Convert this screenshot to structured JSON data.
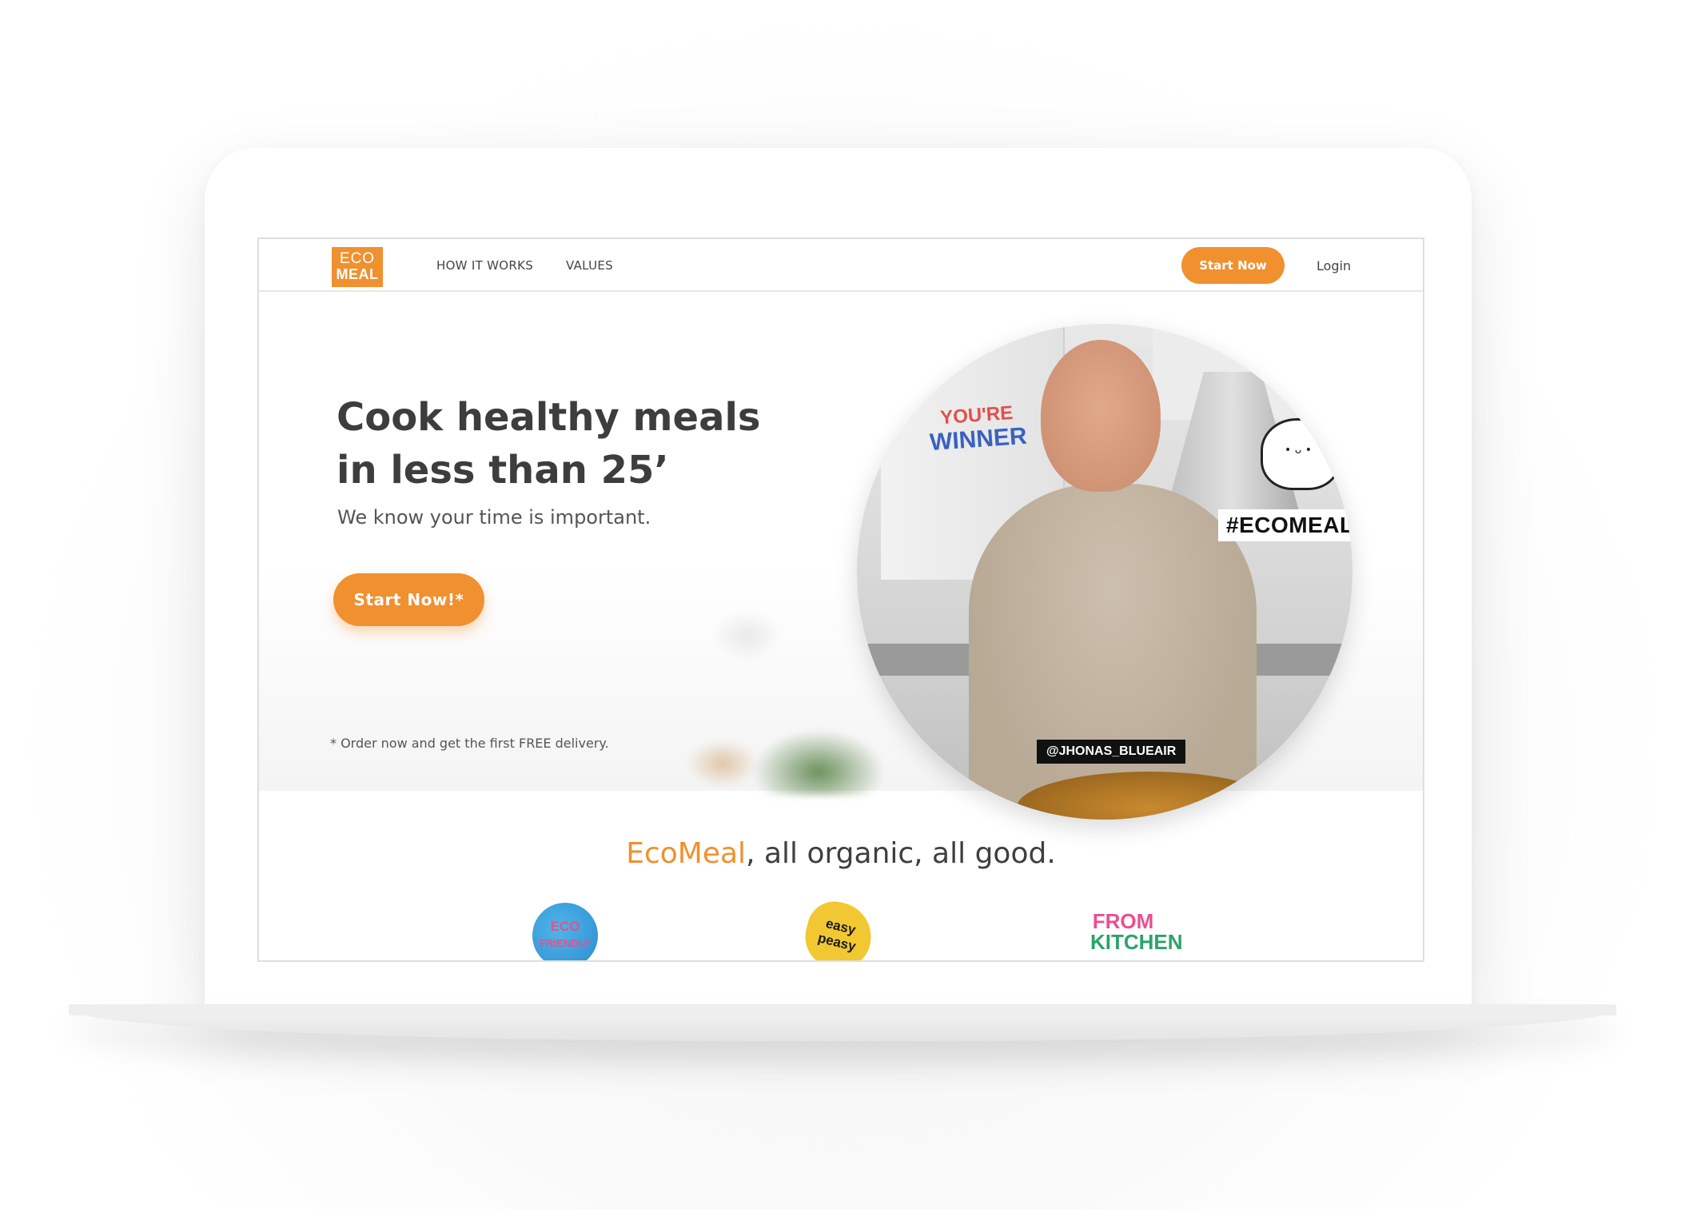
{
  "nav": {
    "logo_line1": "ECO",
    "logo_line2": "MEAL",
    "links": [
      "HOW IT WORKS",
      "VALUES"
    ],
    "start_label": "Start Now",
    "login_label": "Login"
  },
  "hero": {
    "title_line1": "Cook healthy meals",
    "title_line2": "in less than 25’",
    "subtitle": "We know your time is important.",
    "cta_label": "Start Now!*",
    "note": "* Order now and get the first FREE delivery.",
    "photo": {
      "sticker_top": "YOU'RE",
      "sticker_bottom": "WINNER",
      "hashtag": "#ECOMEAL",
      "handle": "@JHONAS_BLUEAIR"
    }
  },
  "section": {
    "brand": "EcoMeal",
    "tagline": ", all organic, all good.",
    "badges": {
      "eco_line1": "ECO",
      "eco_line2": "FRIENDLY",
      "easy_line1": "easy",
      "easy_line2": "peasy",
      "kitchen_line1": "FROM",
      "kitchen_line2": "KITCHEN"
    }
  },
  "colors": {
    "accent": "#f0902f",
    "text": "#3d3d3d"
  }
}
